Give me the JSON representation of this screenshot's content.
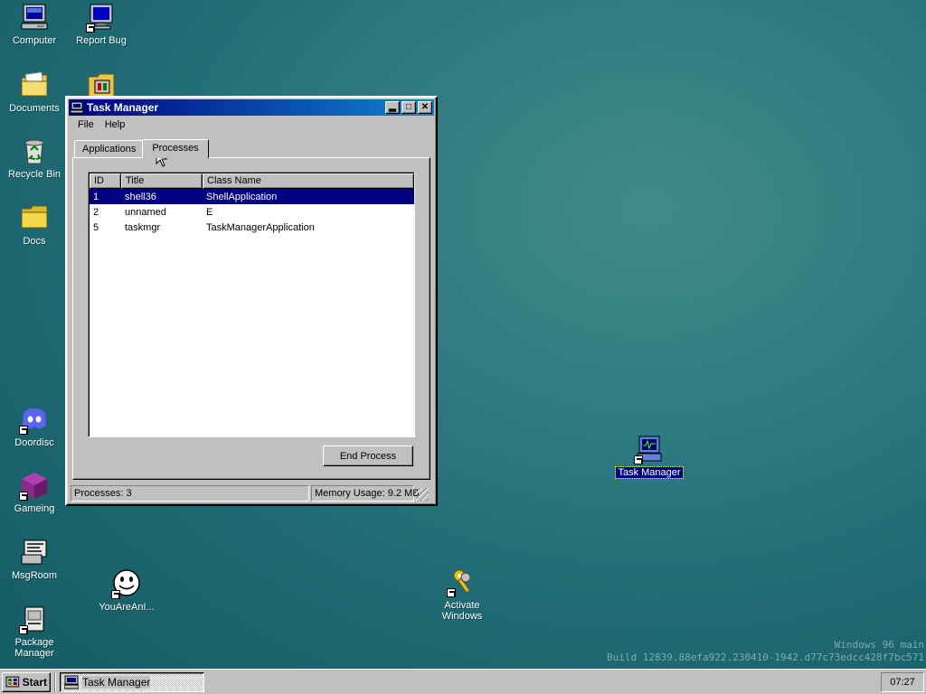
{
  "desktop": {
    "icons": {
      "computer": {
        "label": "Computer",
        "icon": "computer-icon"
      },
      "report_bug": {
        "label": "Report Bug",
        "icon": "monitor-shortcut-icon"
      },
      "documents": {
        "label": "Documents",
        "icon": "folder-documents-icon"
      },
      "unnamed_tool": {
        "label": "",
        "icon": "control-panel-icon"
      },
      "recycle_bin": {
        "label": "Recycle Bin",
        "icon": "recycle-bin-icon"
      },
      "docs": {
        "label": "Docs",
        "icon": "folder-icon"
      },
      "doordisc": {
        "label": "Doordisc",
        "icon": "discord-icon"
      },
      "gameing": {
        "label": "Gameing",
        "icon": "purple-cube-icon"
      },
      "msgroom": {
        "label": "MsgRoom",
        "icon": "msgroom-icon"
      },
      "package_manager": {
        "label": "Package Manager",
        "icon": "package-icon"
      },
      "youareani": {
        "label": "YouAreAnI...",
        "icon": "smiley-icon"
      },
      "activate_windows": {
        "label": "Activate Windows",
        "icon": "keys-icon"
      },
      "task_manager": {
        "label": "Task Manager",
        "icon": "task-manager-icon",
        "selected": true
      }
    },
    "watermark": {
      "line1": "Windows 96 main",
      "line2": "Build 12839.88efa922.230410-1942.d77c73edcc428f7bc571"
    }
  },
  "window": {
    "title": "Task Manager",
    "menu": [
      "File",
      "Help"
    ],
    "tabs": [
      {
        "label": "Applications",
        "active": false
      },
      {
        "label": "Processes",
        "active": true
      }
    ],
    "columns": [
      "ID",
      "Title",
      "Class Name"
    ],
    "rows": [
      {
        "id": "1",
        "title": "shell36",
        "class_name": "ShellApplication",
        "selected": true
      },
      {
        "id": "2",
        "title": "unnamed",
        "class_name": "E",
        "selected": false
      },
      {
        "id": "5",
        "title": "taskmgr",
        "class_name": "TaskManagerApplication",
        "selected": false
      }
    ],
    "end_process_label": "End Process",
    "status": {
      "processes": "Processes: 3",
      "memory": "Memory Usage: 9.2 MB"
    }
  },
  "taskbar": {
    "start_label": "Start",
    "task_button_label": "Task Manager",
    "clock": "07:27"
  },
  "colors": {
    "selection": "#000080",
    "title_gradient_start": "#000080",
    "title_gradient_end": "#1084d0",
    "desktop": "#2c7a80"
  }
}
